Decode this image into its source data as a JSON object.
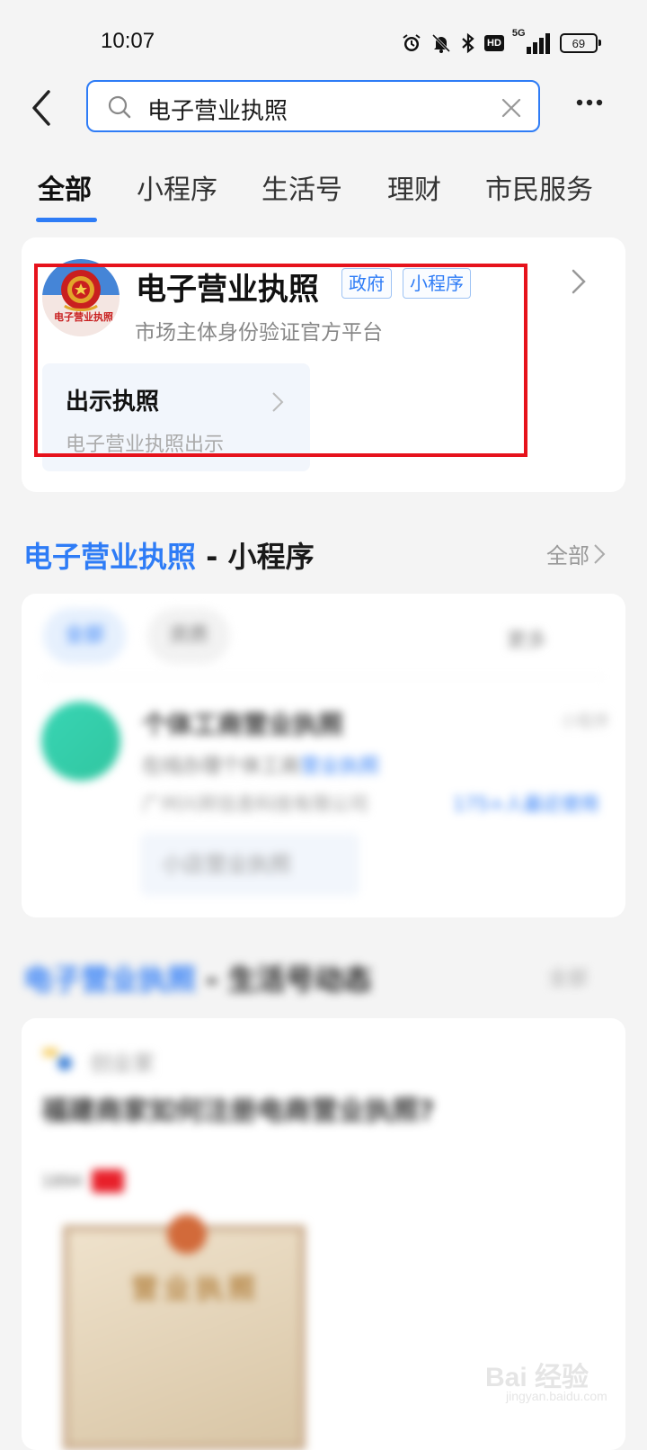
{
  "status_bar": {
    "time": "10:07",
    "icons": [
      "alarm-icon",
      "mute-icon",
      "bluetooth-icon",
      "hd-icon",
      "5g-signal-icon"
    ],
    "hd_label": "HD",
    "network_label": "5G",
    "battery": "69"
  },
  "search": {
    "query": "电子营业执照"
  },
  "tabs": [
    {
      "label": "全部",
      "active": true
    },
    {
      "label": "小程序"
    },
    {
      "label": "生活号"
    },
    {
      "label": "理财"
    },
    {
      "label": "市民服务"
    }
  ],
  "result_card": {
    "title": "电子营业执照",
    "tags": [
      "政府",
      "小程序"
    ],
    "subtitle": "市场主体身份验证官方平台",
    "logo_text": "电子营业执照",
    "service": {
      "title": "出示执照",
      "subtitle": "电子营业执照出示"
    }
  },
  "mini_program_section": {
    "title_highlight": "电子营业执照",
    "title_rest": " - 小程序",
    "more_label": "全部"
  },
  "mini_program_card": {
    "chips": [
      "全部",
      "资质"
    ],
    "sort_label": "更多",
    "app_name": "个体工商营业执照",
    "app_desc_prefix": "在线办理个体工商",
    "app_desc_highlight": "营业执照",
    "app_org": "广州兴邦信息科技有限公司",
    "app_users": "175+人最近使用",
    "app_tagline": "小程序",
    "service_label": "小店营业执照"
  },
  "life_section": {
    "title_highlight": "电子营业执照",
    "title_rest": " - 生活号动态",
    "more_label": "全部",
    "author": "创业家",
    "post_title": "福建商家如何注册电商营业执照?",
    "post_meta": "1894",
    "license_title": "营业执照"
  },
  "watermark": {
    "brand": "Bai 经验",
    "url": "jingyan.baidu.com"
  },
  "colors": {
    "accent": "#2e7cf6",
    "highlight_border": "#e6121c",
    "background": "#f4f4f4"
  }
}
